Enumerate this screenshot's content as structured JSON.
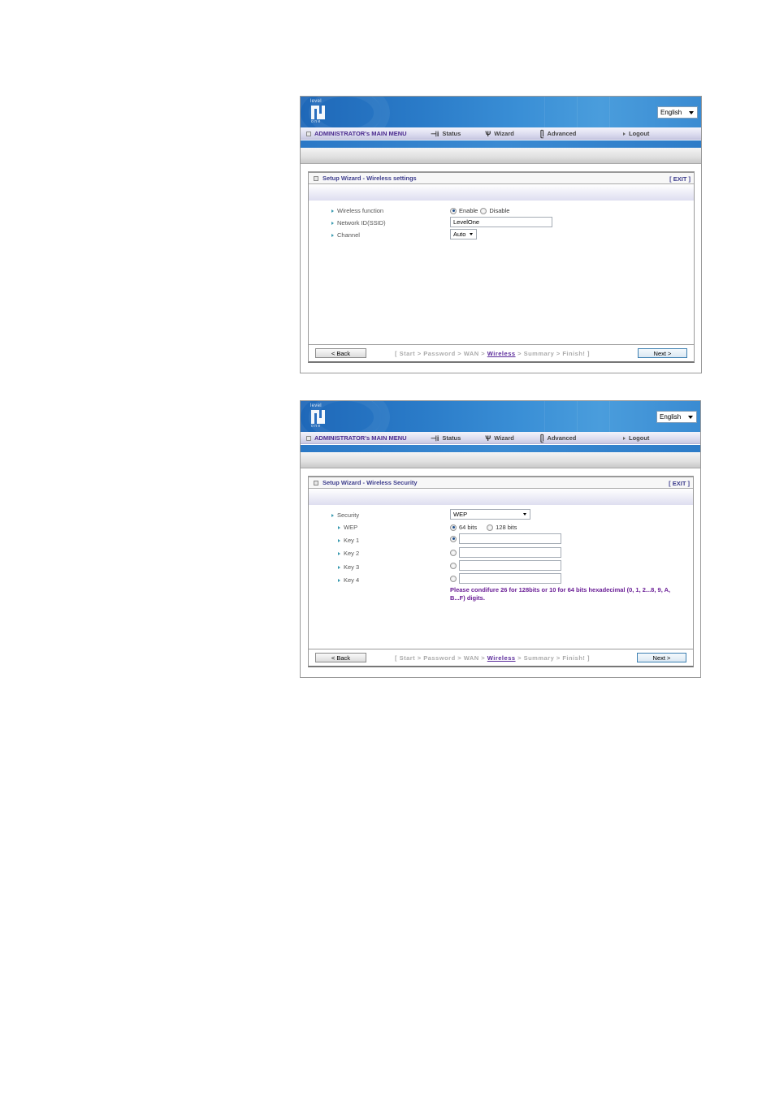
{
  "screens": [
    {
      "header": {
        "logo_top": "level",
        "logo_bottom": "one",
        "language": "English",
        "menu": {
          "admin": "ADMINISTRATOR's MAIN MENU",
          "status": "Status",
          "wizard": "Wizard",
          "advanced": "Advanced",
          "logout": "Logout"
        }
      },
      "panel": {
        "title": "Setup Wizard - Wireless settings",
        "exit": "[ EXIT ]",
        "fields": {
          "wireless_function_label": "Wireless function",
          "enable_label": "Enable",
          "disable_label": "Disable",
          "wireless_function_value": "Enable",
          "ssid_label": "Network ID(SSID)",
          "ssid_value": "LevelOne",
          "channel_label": "Channel",
          "channel_value": "Auto"
        }
      },
      "footer": {
        "back": "< Back",
        "next": "Next >",
        "steps_prefix": "[ Start > Password > WAN > ",
        "steps_current": "Wireless",
        "steps_suffix": " > Summary > Finish! ]"
      }
    },
    {
      "header": {
        "logo_top": "level",
        "logo_bottom": "one",
        "language": "English",
        "menu": {
          "admin": "ADMINISTRATOR's MAIN MENU",
          "status": "Status",
          "wizard": "Wizard",
          "advanced": "Advanced",
          "logout": "Logout"
        }
      },
      "panel": {
        "title": "Setup Wizard - Wireless Security",
        "exit": "[ EXIT ]",
        "fields": {
          "security_label": "Security",
          "security_value": "WEP",
          "wep_label": "WEP",
          "bits64_label": "64 bits",
          "bits128_label": "128 bits",
          "wep_bits_value": "64 bits",
          "keys": [
            {
              "label": "Key 1",
              "value": "",
              "selected": true
            },
            {
              "label": "Key 2",
              "value": "",
              "selected": false
            },
            {
              "label": "Key 3",
              "value": "",
              "selected": false
            },
            {
              "label": "Key 4",
              "value": "",
              "selected": false
            }
          ],
          "note": "Please condifure 26 for 128bits or 10 for 64 bits hexadecimal (0, 1, 2...8, 9, A, B...F) digits."
        }
      },
      "footer": {
        "back": "< Back",
        "next": "Next >",
        "steps_prefix": "[ Start > Password > WAN > ",
        "steps_current": "Wireless",
        "steps_suffix": " > Summary > Finish! ]"
      }
    }
  ]
}
